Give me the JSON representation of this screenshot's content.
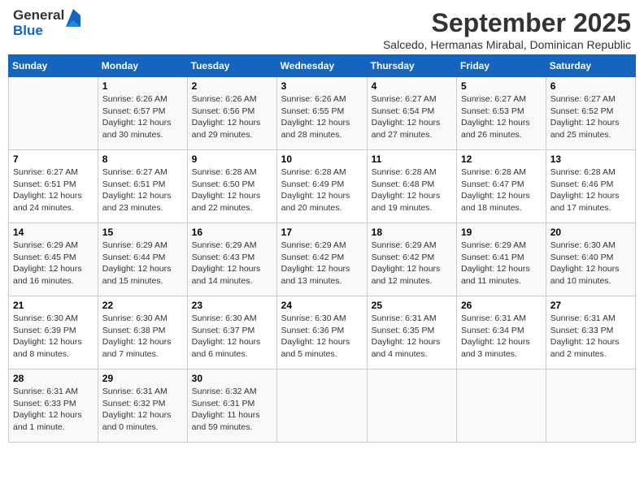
{
  "logo": {
    "text_general": "General",
    "text_blue": "Blue"
  },
  "header": {
    "month_title": "September 2025",
    "subtitle": "Salcedo, Hermanas Mirabal, Dominican Republic"
  },
  "weekdays": [
    "Sunday",
    "Monday",
    "Tuesday",
    "Wednesday",
    "Thursday",
    "Friday",
    "Saturday"
  ],
  "weeks": [
    [
      {
        "day": "",
        "info": ""
      },
      {
        "day": "1",
        "info": "Sunrise: 6:26 AM\nSunset: 6:57 PM\nDaylight: 12 hours\nand 30 minutes."
      },
      {
        "day": "2",
        "info": "Sunrise: 6:26 AM\nSunset: 6:56 PM\nDaylight: 12 hours\nand 29 minutes."
      },
      {
        "day": "3",
        "info": "Sunrise: 6:26 AM\nSunset: 6:55 PM\nDaylight: 12 hours\nand 28 minutes."
      },
      {
        "day": "4",
        "info": "Sunrise: 6:27 AM\nSunset: 6:54 PM\nDaylight: 12 hours\nand 27 minutes."
      },
      {
        "day": "5",
        "info": "Sunrise: 6:27 AM\nSunset: 6:53 PM\nDaylight: 12 hours\nand 26 minutes."
      },
      {
        "day": "6",
        "info": "Sunrise: 6:27 AM\nSunset: 6:52 PM\nDaylight: 12 hours\nand 25 minutes."
      }
    ],
    [
      {
        "day": "7",
        "info": "Sunrise: 6:27 AM\nSunset: 6:51 PM\nDaylight: 12 hours\nand 24 minutes."
      },
      {
        "day": "8",
        "info": "Sunrise: 6:27 AM\nSunset: 6:51 PM\nDaylight: 12 hours\nand 23 minutes."
      },
      {
        "day": "9",
        "info": "Sunrise: 6:28 AM\nSunset: 6:50 PM\nDaylight: 12 hours\nand 22 minutes."
      },
      {
        "day": "10",
        "info": "Sunrise: 6:28 AM\nSunset: 6:49 PM\nDaylight: 12 hours\nand 20 minutes."
      },
      {
        "day": "11",
        "info": "Sunrise: 6:28 AM\nSunset: 6:48 PM\nDaylight: 12 hours\nand 19 minutes."
      },
      {
        "day": "12",
        "info": "Sunrise: 6:28 AM\nSunset: 6:47 PM\nDaylight: 12 hours\nand 18 minutes."
      },
      {
        "day": "13",
        "info": "Sunrise: 6:28 AM\nSunset: 6:46 PM\nDaylight: 12 hours\nand 17 minutes."
      }
    ],
    [
      {
        "day": "14",
        "info": "Sunrise: 6:29 AM\nSunset: 6:45 PM\nDaylight: 12 hours\nand 16 minutes."
      },
      {
        "day": "15",
        "info": "Sunrise: 6:29 AM\nSunset: 6:44 PM\nDaylight: 12 hours\nand 15 minutes."
      },
      {
        "day": "16",
        "info": "Sunrise: 6:29 AM\nSunset: 6:43 PM\nDaylight: 12 hours\nand 14 minutes."
      },
      {
        "day": "17",
        "info": "Sunrise: 6:29 AM\nSunset: 6:42 PM\nDaylight: 12 hours\nand 13 minutes."
      },
      {
        "day": "18",
        "info": "Sunrise: 6:29 AM\nSunset: 6:42 PM\nDaylight: 12 hours\nand 12 minutes."
      },
      {
        "day": "19",
        "info": "Sunrise: 6:29 AM\nSunset: 6:41 PM\nDaylight: 12 hours\nand 11 minutes."
      },
      {
        "day": "20",
        "info": "Sunrise: 6:30 AM\nSunset: 6:40 PM\nDaylight: 12 hours\nand 10 minutes."
      }
    ],
    [
      {
        "day": "21",
        "info": "Sunrise: 6:30 AM\nSunset: 6:39 PM\nDaylight: 12 hours\nand 8 minutes."
      },
      {
        "day": "22",
        "info": "Sunrise: 6:30 AM\nSunset: 6:38 PM\nDaylight: 12 hours\nand 7 minutes."
      },
      {
        "day": "23",
        "info": "Sunrise: 6:30 AM\nSunset: 6:37 PM\nDaylight: 12 hours\nand 6 minutes."
      },
      {
        "day": "24",
        "info": "Sunrise: 6:30 AM\nSunset: 6:36 PM\nDaylight: 12 hours\nand 5 minutes."
      },
      {
        "day": "25",
        "info": "Sunrise: 6:31 AM\nSunset: 6:35 PM\nDaylight: 12 hours\nand 4 minutes."
      },
      {
        "day": "26",
        "info": "Sunrise: 6:31 AM\nSunset: 6:34 PM\nDaylight: 12 hours\nand 3 minutes."
      },
      {
        "day": "27",
        "info": "Sunrise: 6:31 AM\nSunset: 6:33 PM\nDaylight: 12 hours\nand 2 minutes."
      }
    ],
    [
      {
        "day": "28",
        "info": "Sunrise: 6:31 AM\nSunset: 6:33 PM\nDaylight: 12 hours\nand 1 minute."
      },
      {
        "day": "29",
        "info": "Sunrise: 6:31 AM\nSunset: 6:32 PM\nDaylight: 12 hours\nand 0 minutes."
      },
      {
        "day": "30",
        "info": "Sunrise: 6:32 AM\nSunset: 6:31 PM\nDaylight: 11 hours\nand 59 minutes."
      },
      {
        "day": "",
        "info": ""
      },
      {
        "day": "",
        "info": ""
      },
      {
        "day": "",
        "info": ""
      },
      {
        "day": "",
        "info": ""
      }
    ]
  ]
}
